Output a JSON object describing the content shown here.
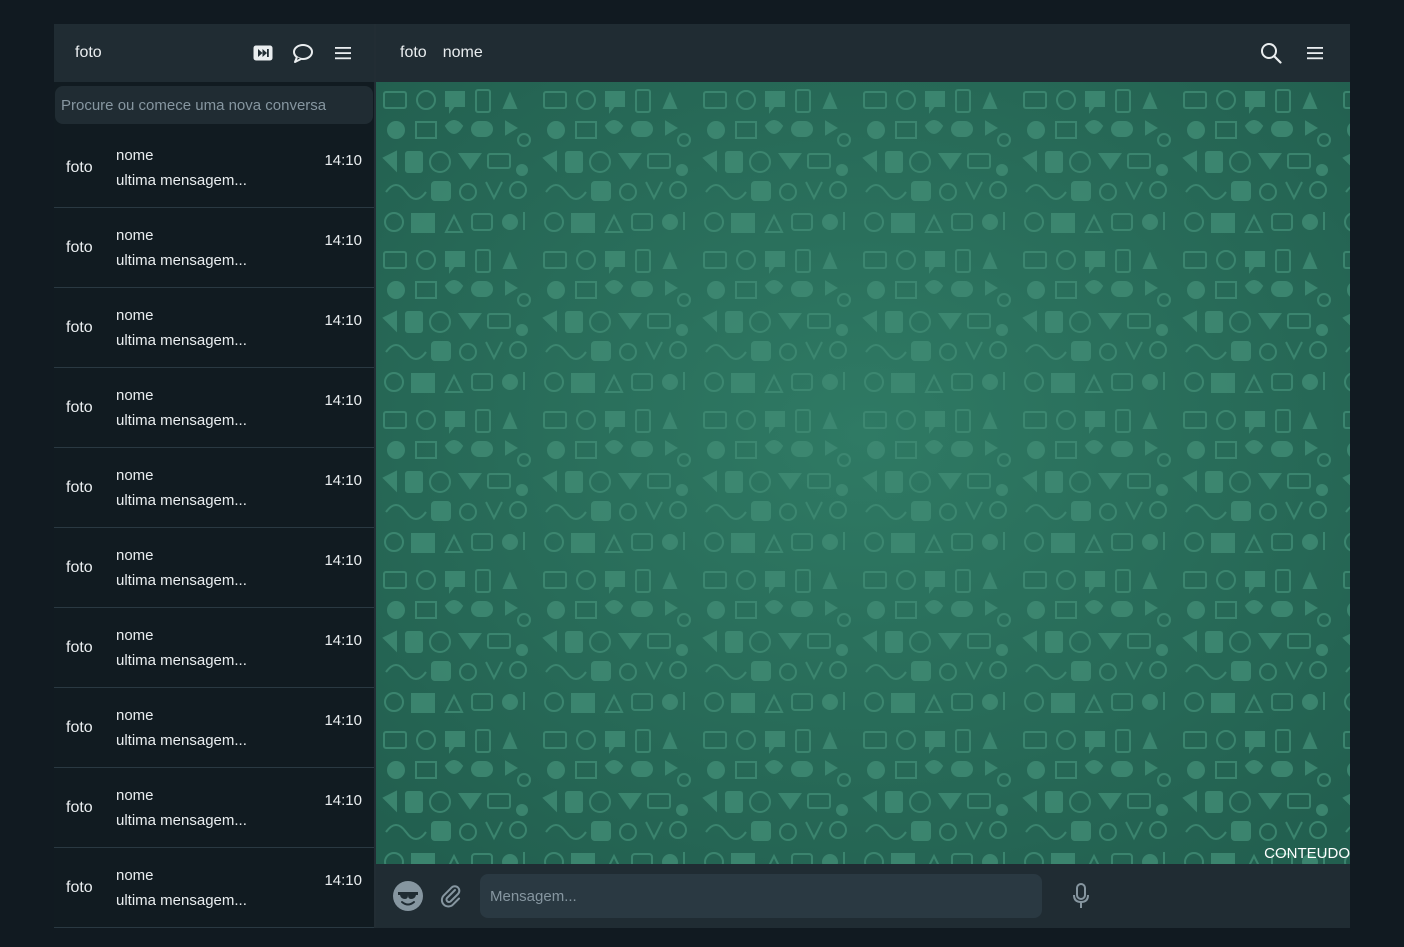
{
  "sidebar": {
    "header": {
      "photo": "foto"
    },
    "icons": [
      "status-icon",
      "new-chat-icon",
      "menu-icon"
    ],
    "search": {
      "placeholder": "Procure ou comece uma nova conversa",
      "value": ""
    },
    "chats": [
      {
        "photo": "foto",
        "name": "nome",
        "last": "ultima mensagem...",
        "time": "14:10"
      },
      {
        "photo": "foto",
        "name": "nome",
        "last": "ultima mensagem...",
        "time": "14:10"
      },
      {
        "photo": "foto",
        "name": "nome",
        "last": "ultima mensagem...",
        "time": "14:10"
      },
      {
        "photo": "foto",
        "name": "nome",
        "last": "ultima mensagem...",
        "time": "14:10"
      },
      {
        "photo": "foto",
        "name": "nome",
        "last": "ultima mensagem...",
        "time": "14:10"
      },
      {
        "photo": "foto",
        "name": "nome",
        "last": "ultima mensagem...",
        "time": "14:10"
      },
      {
        "photo": "foto",
        "name": "nome",
        "last": "ultima mensagem...",
        "time": "14:10"
      },
      {
        "photo": "foto",
        "name": "nome",
        "last": "ultima mensagem...",
        "time": "14:10"
      },
      {
        "photo": "foto",
        "name": "nome",
        "last": "ultima mensagem...",
        "time": "14:10"
      },
      {
        "photo": "foto",
        "name": "nome",
        "last": "ultima mensagem...",
        "time": "14:10"
      }
    ]
  },
  "main": {
    "header": {
      "photo": "foto",
      "name": "nome"
    },
    "icons": [
      "search-icon",
      "menu-icon"
    ],
    "content_label": "CONTEUDO",
    "composer": {
      "placeholder": "Mensagem...",
      "value": "",
      "icons": [
        "emoji-icon",
        "paperclip-icon",
        "microphone-icon"
      ]
    }
  },
  "colors": {
    "page_bg": "#111a21",
    "panel_bg": "#111b21",
    "header_bg": "#202c33",
    "input_bg": "#2a3942",
    "chat_bg": "#2b6e5c",
    "pattern": "#3f8a73",
    "text": "#e9edef",
    "placeholder": "#8696a0"
  }
}
